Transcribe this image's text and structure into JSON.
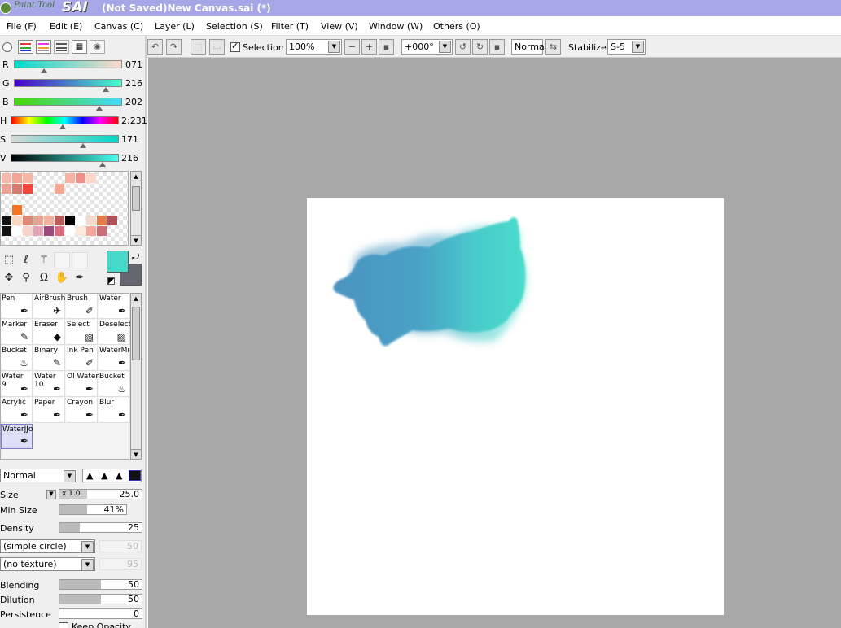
{
  "window": {
    "title": "(Not Saved)New Canvas.sai (*)",
    "app_logo_small": "Paint Tool",
    "app_logo_big": "SAI"
  },
  "menu": [
    "File (F)",
    "Edit (E)",
    "Canvas (C)",
    "Layer (L)",
    "Selection (S)",
    "Filter (T)",
    "View (V)",
    "Window (W)",
    "Others (O)"
  ],
  "toolbar": {
    "selection_label": "Selection",
    "selection_checked": true,
    "zoom": "100%",
    "rotation": "+000°",
    "blend": "Normal",
    "stabilizer_label": "Stabilizer",
    "stabilizer_value": "S-5"
  },
  "colors": {
    "foreground": "#47d8ca",
    "background": "#666670"
  },
  "sliders": [
    {
      "label": "R",
      "value": "071",
      "pos": 0.28
    },
    {
      "label": "G",
      "value": "216",
      "pos": 0.85
    },
    {
      "label": "B",
      "value": "202",
      "pos": 0.79
    },
    {
      "label": "H",
      "value": "2:231",
      "pos": 0.48
    },
    {
      "label": "S",
      "value": "171",
      "pos": 0.67
    },
    {
      "label": "V",
      "value": "216",
      "pos": 0.85
    }
  ],
  "brushes": [
    {
      "label": "Pen",
      "icon": "pen-icon"
    },
    {
      "label": "AirBrush",
      "icon": "airbrush-icon"
    },
    {
      "label": "Brush",
      "icon": "brush-icon"
    },
    {
      "label": "Water",
      "icon": "water-icon"
    },
    {
      "label": "Marker",
      "icon": "marker-icon"
    },
    {
      "label": "Eraser",
      "icon": "eraser-icon"
    },
    {
      "label": "Select",
      "icon": "select-icon"
    },
    {
      "label": "Deselect",
      "icon": "deselect-icon"
    },
    {
      "label": "Bucket",
      "icon": "bucket-icon"
    },
    {
      "label": "Binary",
      "icon": "binary-icon"
    },
    {
      "label": "Ink Pen",
      "icon": "ink-pen-icon"
    },
    {
      "label": "WaterMi",
      "icon": "watermix-icon"
    },
    {
      "label": "Water\n9",
      "icon": "water-icon"
    },
    {
      "label": "Water\n10",
      "icon": "water-icon"
    },
    {
      "label": "Ol Water",
      "icon": "oil-water-icon"
    },
    {
      "label": "Bucket",
      "icon": "bucket-icon"
    },
    {
      "label": "Acrylic",
      "icon": "acrylic-icon"
    },
    {
      "label": "Paper",
      "icon": "paper-icon"
    },
    {
      "label": "Crayon",
      "icon": "crayon-icon"
    },
    {
      "label": "Blur",
      "icon": "blur-icon"
    },
    {
      "label": "WaterJJo",
      "icon": "water-icon",
      "selected": true
    }
  ],
  "brush_props": {
    "mode": "Normal",
    "size_label": "Size",
    "size_multiplier": "x 1.0",
    "size_value": "25.0",
    "min_size_label": "Min Size",
    "min_size_value": "41%",
    "min_size_fill": 0.41,
    "density_label": "Density",
    "density_value": "25",
    "density_fill": 0.25,
    "shape": "(simple circle)",
    "shape_value": "50",
    "texture": "(no texture)",
    "texture_value": "95",
    "blending_label": "Blending",
    "blending_value": "50",
    "blending_fill": 0.5,
    "dilution_label": "Dilution",
    "dilution_value": "50",
    "dilution_fill": 0.5,
    "persistence_label": "Persistence",
    "persistence_value": "0",
    "persistence_fill": 0,
    "keep_opacity_label": "Keep Opacity"
  }
}
